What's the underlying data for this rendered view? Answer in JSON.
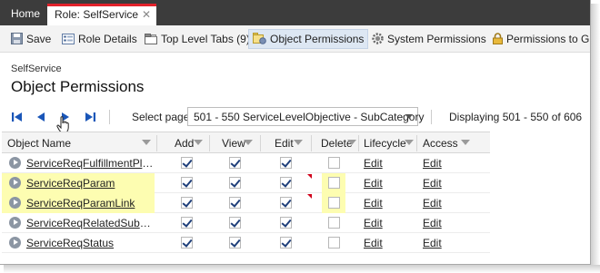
{
  "tabs": {
    "home_label": "Home",
    "role_label": "Role: SelfService",
    "close_glyph": "✕"
  },
  "toolbar": {
    "save_label": "Save",
    "role_details_label": "Role Details",
    "top_level_tabs_label": "Top Level Tabs (9)",
    "object_permissions_label": "Object Permissions",
    "system_permissions_label": "System Permissions",
    "permissions_to_label": "Permissions to G"
  },
  "page": {
    "breadcrumb": "SelfService",
    "title": "Object Permissions"
  },
  "pager": {
    "select_page_label": "Select page",
    "selected_page": "501 - 550 ServiceLevelObjective - SubCategory",
    "displaying": "Displaying 501 - 550 of 606"
  },
  "grid": {
    "headers": {
      "object_name": "Object Name",
      "add": "Add",
      "view": "View",
      "edit": "Edit",
      "delete": "Delete",
      "lifecycle": "Lifecycle",
      "access": "Access"
    },
    "rows": [
      {
        "name": "ServiceReqFulfillmentPlan...",
        "add": true,
        "view": true,
        "edit": true,
        "delete": false,
        "lifecycle": "Edit",
        "access": "Edit",
        "highlight": false,
        "changed": false
      },
      {
        "name": "ServiceReqParam",
        "add": true,
        "view": true,
        "edit": true,
        "delete": false,
        "lifecycle": "Edit",
        "access": "Edit",
        "highlight": true,
        "changed": true
      },
      {
        "name": "ServiceReqParamLink",
        "add": true,
        "view": true,
        "edit": true,
        "delete": false,
        "lifecycle": "Edit",
        "access": "Edit",
        "highlight": true,
        "changed": true
      },
      {
        "name": "ServiceReqRelatedSubscr...",
        "add": true,
        "view": true,
        "edit": true,
        "delete": false,
        "lifecycle": "Edit",
        "access": "Edit",
        "highlight": false,
        "changed": false
      },
      {
        "name": "ServiceReqStatus",
        "add": true,
        "view": true,
        "edit": true,
        "delete": false,
        "lifecycle": "Edit",
        "access": "Edit",
        "highlight": false,
        "changed": false
      }
    ]
  },
  "colors": {
    "tabbar": "#3c3c3c",
    "active_tab_accent": "#e2222b",
    "highlight": "#fdfdb1",
    "checkmark": "#1f3f7a",
    "pager_icon": "#1a56b8"
  },
  "icons": {
    "save": "floppy-save-icon",
    "role_details": "details-grid-icon",
    "top_level_tabs": "tabs-icon",
    "object_permissions": "object-permissions-icon",
    "system_permissions": "gear-icon",
    "permissions_to": "lock-icon",
    "row": "expand-arrow-icon"
  }
}
